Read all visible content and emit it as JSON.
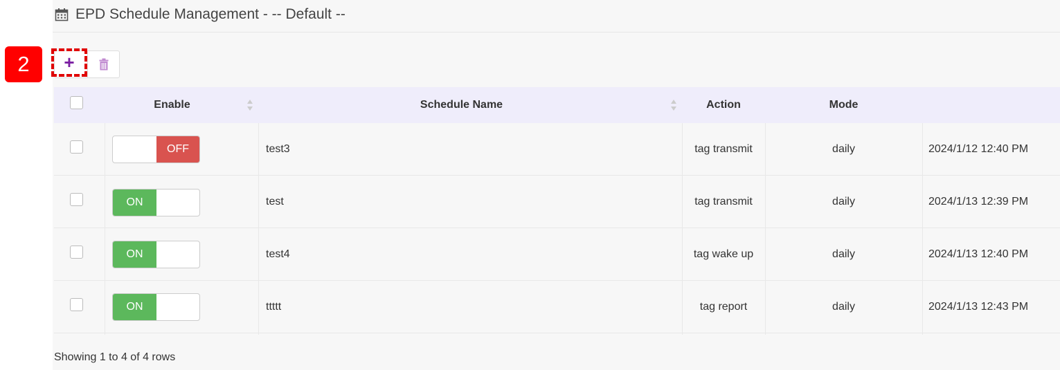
{
  "header": {
    "title": "EPD Schedule Management - -- Default --",
    "icon": "calendar-icon"
  },
  "step_badge": "2",
  "toolbar": {
    "add_label": "+",
    "add_icon": "plus-icon",
    "delete_icon": "trash-icon"
  },
  "table": {
    "columns": {
      "enable": "Enable",
      "schedule_name": "Schedule Name",
      "action": "Action",
      "mode": "Mode",
      "time": ""
    },
    "rows": [
      {
        "enabled": false,
        "toggle_label": "OFF",
        "name": "test3",
        "action": "tag transmit",
        "mode": "daily",
        "time": "2024/1/12 12:40 PM"
      },
      {
        "enabled": true,
        "toggle_label": "ON",
        "name": "test",
        "action": "tag transmit",
        "mode": "daily",
        "time": "2024/1/13 12:39 PM"
      },
      {
        "enabled": true,
        "toggle_label": "ON",
        "name": "test4",
        "action": "tag wake up",
        "mode": "daily",
        "time": "2024/1/13 12:40 PM"
      },
      {
        "enabled": true,
        "toggle_label": "ON",
        "name": "ttttt",
        "action": "tag report",
        "mode": "daily",
        "time": "2024/1/13 12:43 PM"
      }
    ]
  },
  "footer": {
    "status": "Showing 1 to 4 of 4 rows"
  },
  "colors": {
    "on": "#5cb85c",
    "off": "#d9534f",
    "header_bg": "#efedfb",
    "accent": "#7b1fa2",
    "highlight": "#ff0000"
  }
}
